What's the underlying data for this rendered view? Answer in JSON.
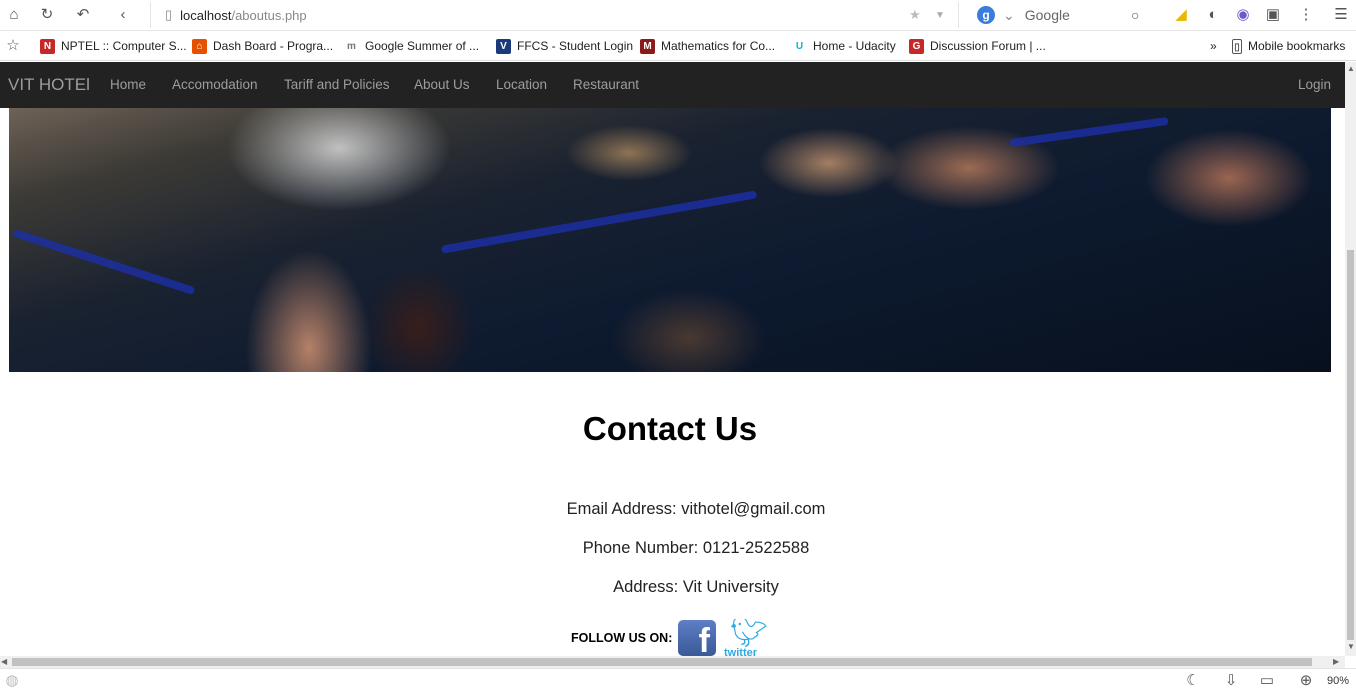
{
  "browser": {
    "url_host": "localhost",
    "url_path": "/aboutus.php",
    "search_engine_label": "Google",
    "zoom_level": "90%",
    "bookmarks": [
      {
        "label": "NPTEL :: Computer S...",
        "icon": "nptel-icon",
        "color": "#c62828"
      },
      {
        "label": "Dash Board - Progra...",
        "icon": "dashboard-icon",
        "color": "#e65100"
      },
      {
        "label": "Google Summer of ...",
        "icon": "m-icon",
        "color": "#777777"
      },
      {
        "label": "FFCS - Student Login",
        "icon": "vit-icon",
        "color": "#1a3a7a"
      },
      {
        "label": "Mathematics for Co...",
        "icon": "mit-icon",
        "color": "#8b1a1a"
      },
      {
        "label": "Home - Udacity",
        "icon": "udacity-icon",
        "color": "#02b3e4"
      },
      {
        "label": "Discussion Forum | ...",
        "icon": "g-icon",
        "color": "#c62828"
      }
    ],
    "more_bookmarks": "»",
    "mobile_bookmarks": "Mobile bookmarks"
  },
  "navbar": {
    "brand": "VIT HOTEl",
    "links": [
      "Home",
      "Accomodation",
      "Tariff and Policies",
      "About Us",
      "Location",
      "Restaurant"
    ],
    "login": "Login"
  },
  "contact": {
    "title": "Contact Us",
    "email": "Email Address: vithotel@gmail.com",
    "phone": "Phone Number: 0121-2522588",
    "address": "Address: Vit University",
    "follow": "FOLLOW US ON:",
    "facebook_glyph": "f",
    "twitter_text": "twitter"
  }
}
